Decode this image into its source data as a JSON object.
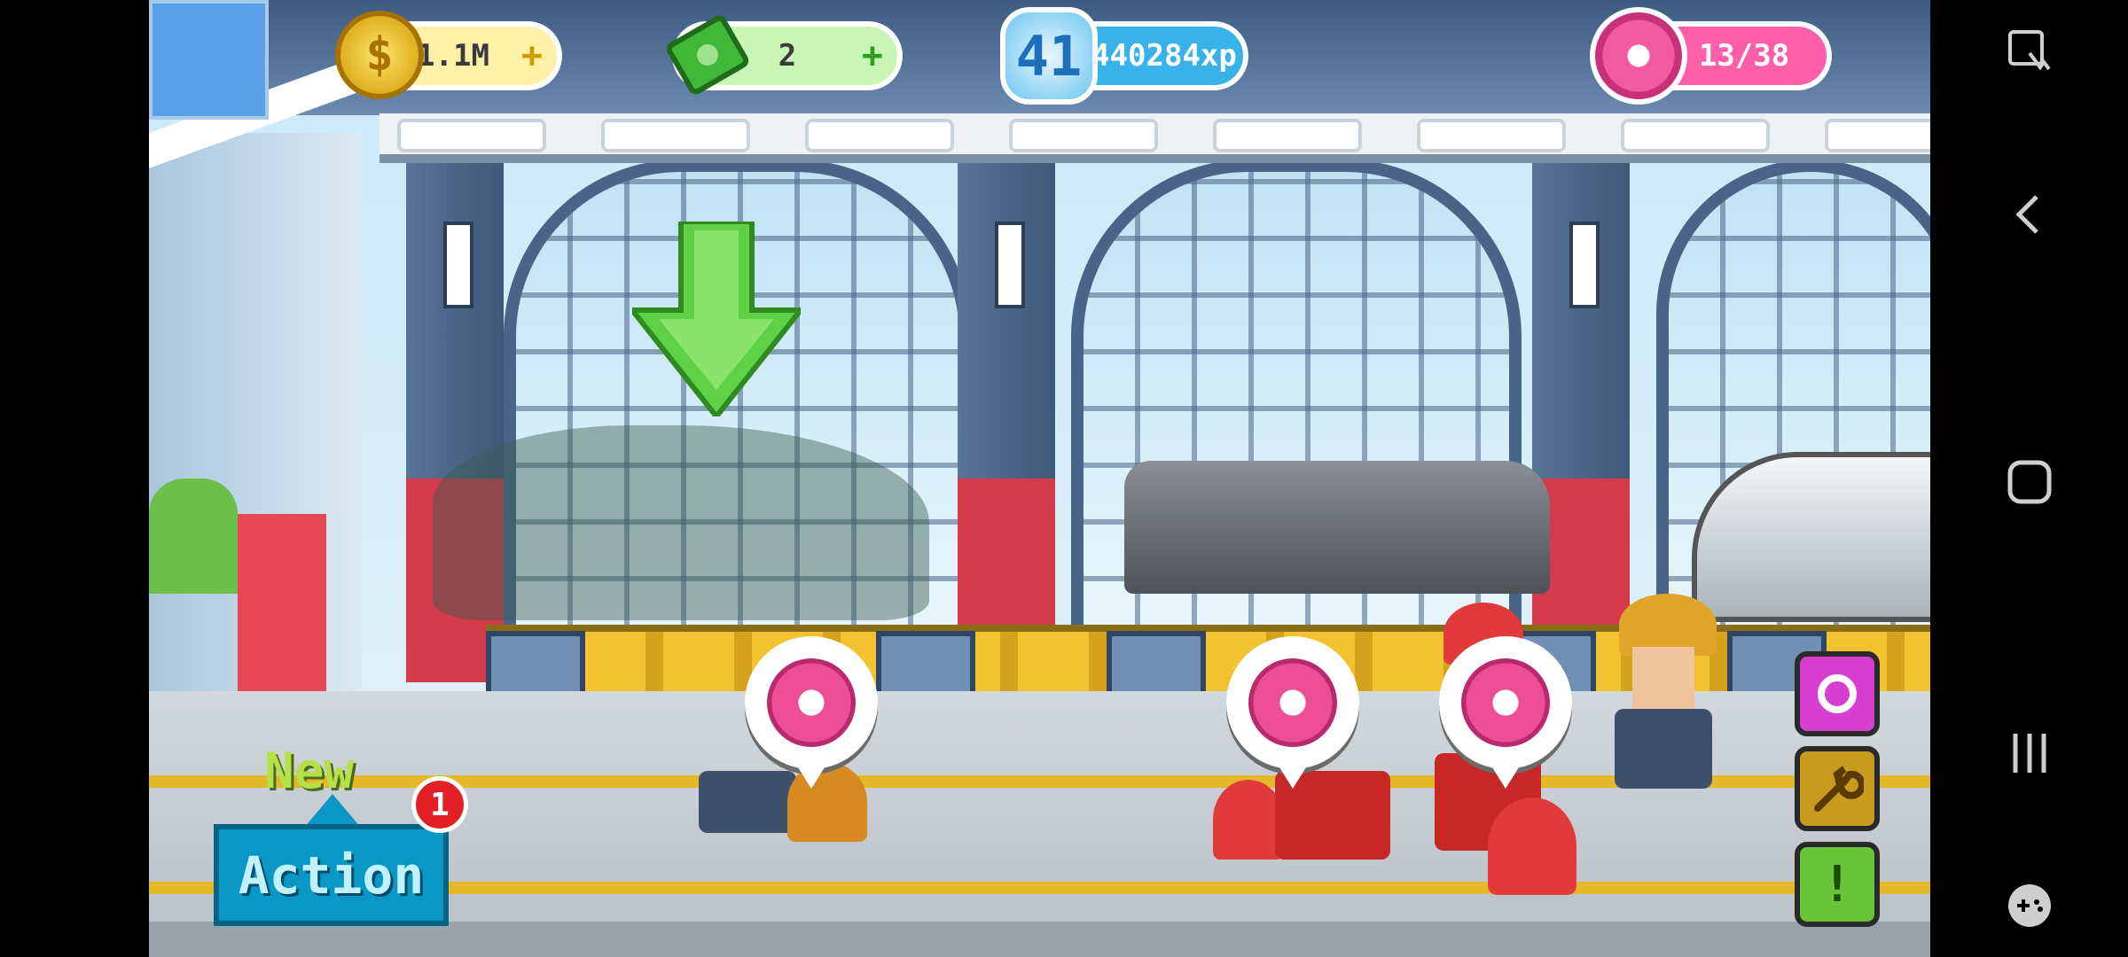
{
  "hud": {
    "coins": "1.1M",
    "coins_plus": "+",
    "coin_symbol": "$",
    "cash": "2",
    "cash_plus": "+",
    "level": "41",
    "xp": "440284xp",
    "donuts": "13/38"
  },
  "action": {
    "new_label": "New",
    "button_label": "Action",
    "badge_count": "1"
  },
  "side_buttons": {
    "alert_label": "!"
  },
  "icons": {
    "coin": "coin-icon",
    "cash": "cash-icon",
    "donut": "donut-icon",
    "wrench": "wrench-icon",
    "target": "target-icon",
    "alert": "exclamation-icon"
  },
  "colors": {
    "action_button": "#0a97c6",
    "badge": "#e21f26",
    "donut": "#ec4f95",
    "xp_bar": "#37b3ea"
  }
}
